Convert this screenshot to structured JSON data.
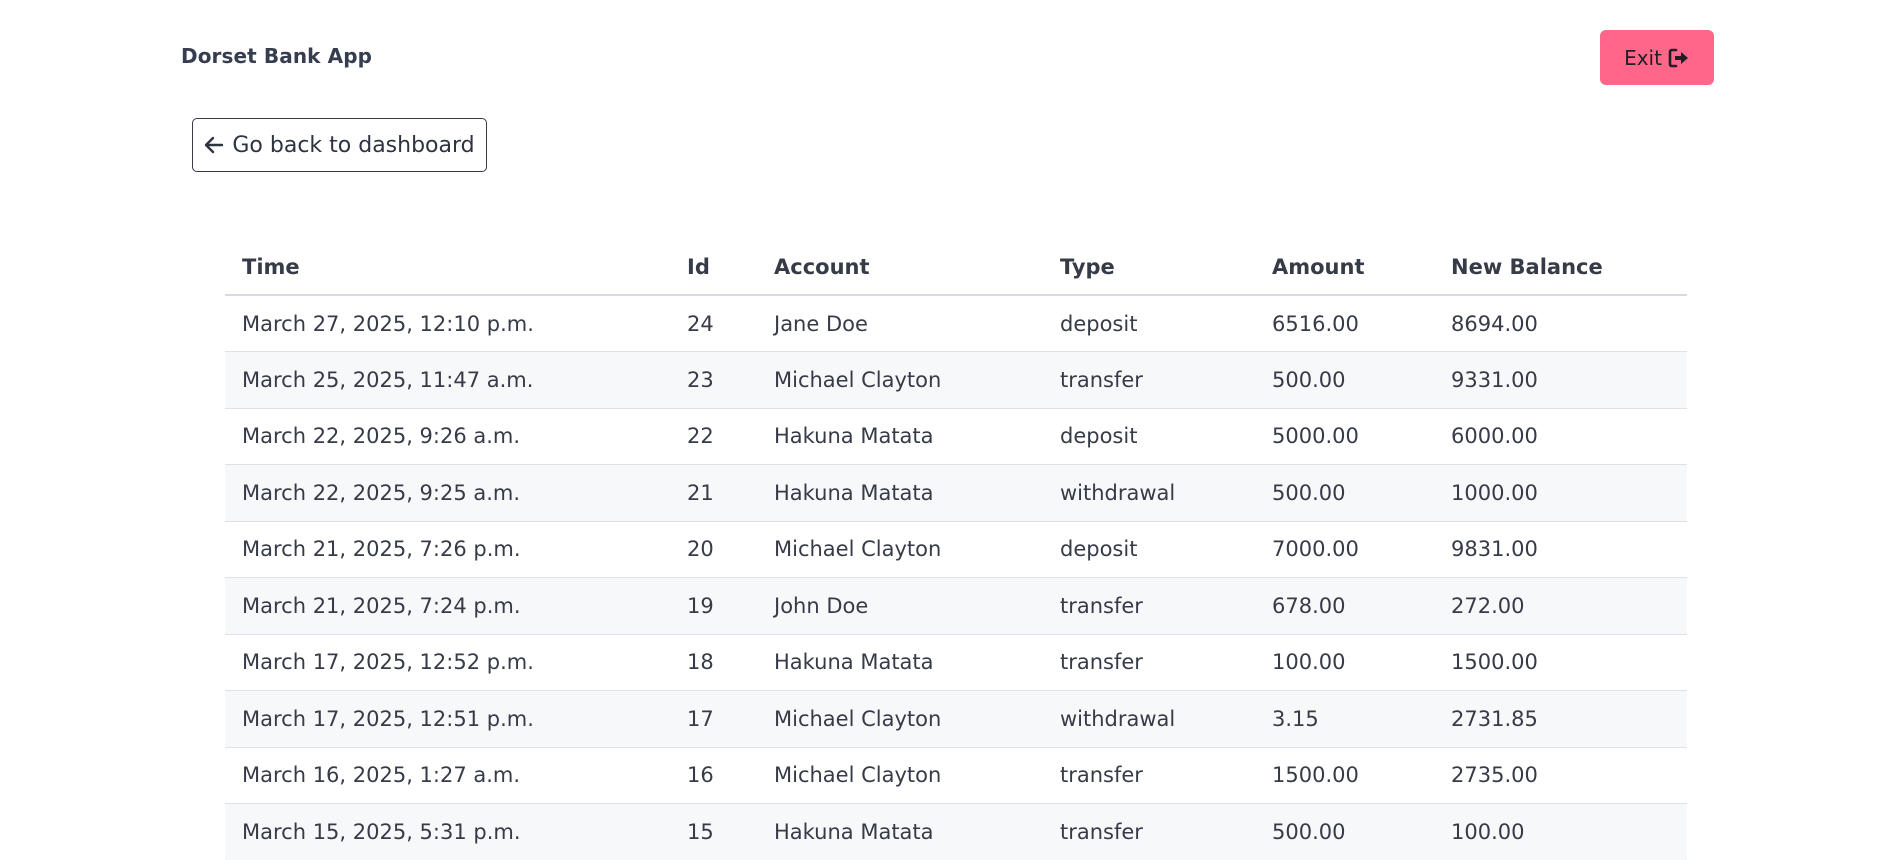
{
  "app": {
    "title": "Dorset Bank App",
    "exit_label": "Exit"
  },
  "nav": {
    "back_label": "Go back to dashboard"
  },
  "colors": {
    "exit_button_bg": "#ff6689",
    "striped_row_bg": "#f7f8fa",
    "text": "#363b47"
  },
  "icons": {
    "exit": "sign-out-icon",
    "back": "arrow-left-icon"
  },
  "table": {
    "headers": [
      "Time",
      "Id",
      "Account",
      "Type",
      "Amount",
      "New Balance"
    ],
    "rows": [
      [
        "March 27, 2025, 12:10 p.m.",
        "24",
        "Jane Doe",
        "deposit",
        "6516.00",
        "8694.00"
      ],
      [
        "March 25, 2025, 11:47 a.m.",
        "23",
        "Michael Clayton",
        "transfer",
        "500.00",
        "9331.00"
      ],
      [
        "March 22, 2025, 9:26 a.m.",
        "22",
        "Hakuna Matata",
        "deposit",
        "5000.00",
        "6000.00"
      ],
      [
        "March 22, 2025, 9:25 a.m.",
        "21",
        "Hakuna Matata",
        "withdrawal",
        "500.00",
        "1000.00"
      ],
      [
        "March 21, 2025, 7:26 p.m.",
        "20",
        "Michael Clayton",
        "deposit",
        "7000.00",
        "9831.00"
      ],
      [
        "March 21, 2025, 7:24 p.m.",
        "19",
        "John Doe",
        "transfer",
        "678.00",
        "272.00"
      ],
      [
        "March 17, 2025, 12:52 p.m.",
        "18",
        "Hakuna Matata",
        "transfer",
        "100.00",
        "1500.00"
      ],
      [
        "March 17, 2025, 12:51 p.m.",
        "17",
        "Michael Clayton",
        "withdrawal",
        "3.15",
        "2731.85"
      ],
      [
        "March 16, 2025, 1:27 a.m.",
        "16",
        "Michael Clayton",
        "transfer",
        "1500.00",
        "2735.00"
      ],
      [
        "March 15, 2025, 5:31 p.m.",
        "15",
        "Hakuna Matata",
        "transfer",
        "500.00",
        "100.00"
      ]
    ]
  }
}
